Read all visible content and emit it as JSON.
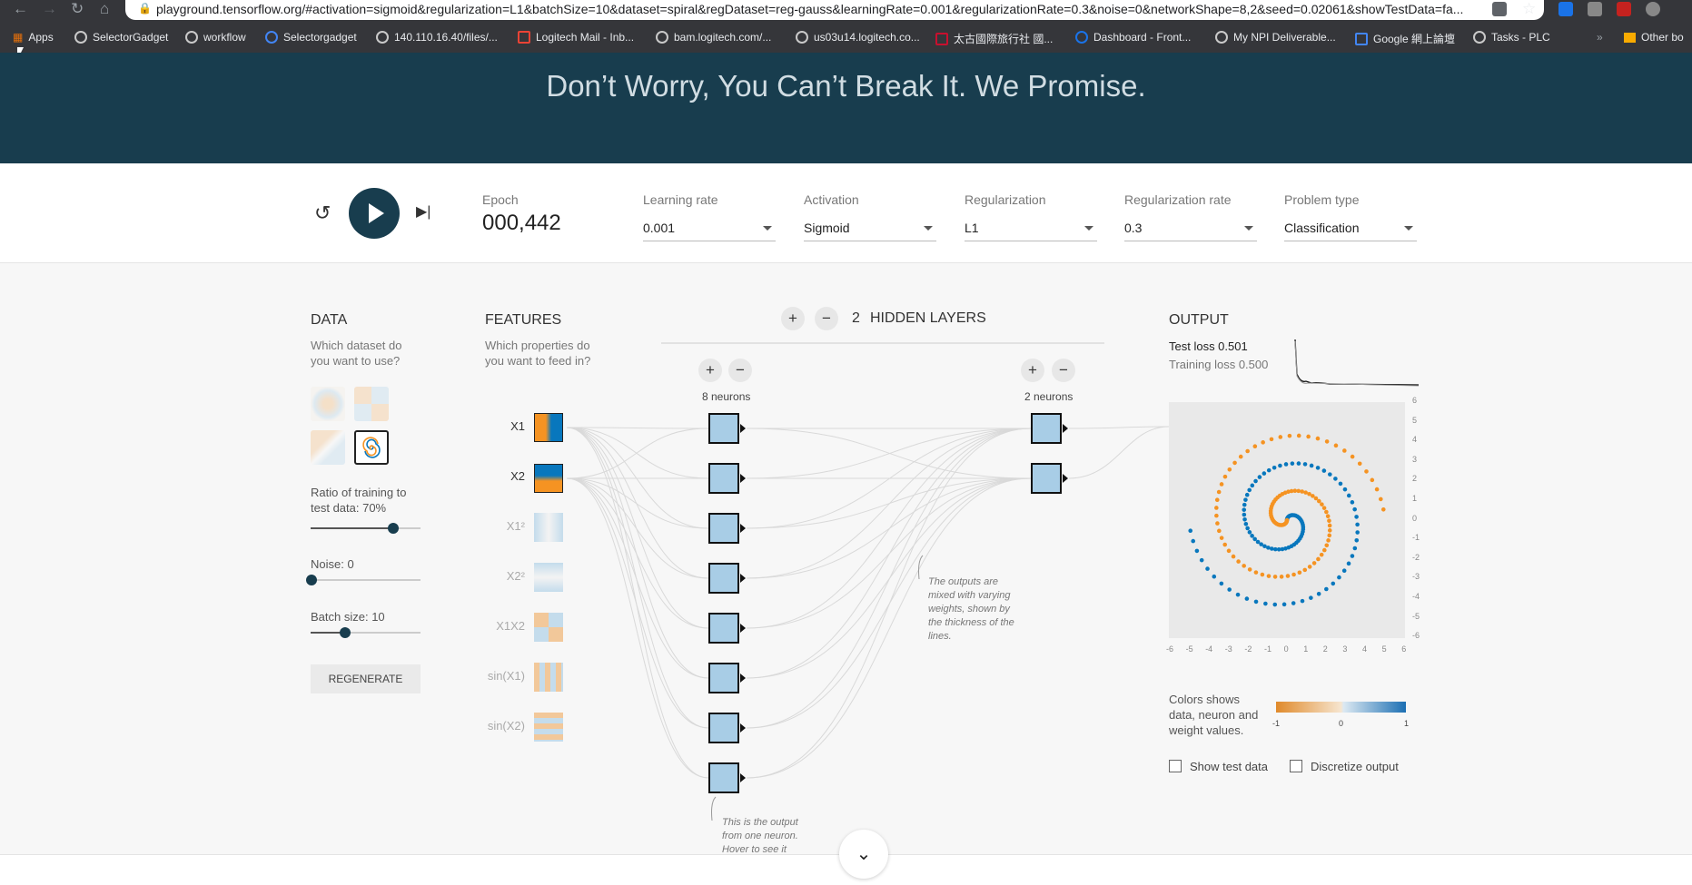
{
  "browser": {
    "url": "playground.tensorflow.org/#activation=sigmoid&regularization=L1&batchSize=10&dataset=spiral&regDataset=reg-gauss&learningRate=0.001&regularizationRate=0.3&noise=0&networkShape=8,2&seed=0.02061&showTestData=fa...",
    "bookmarks": [
      "Apps",
      "SelectorGadget",
      "workflow",
      "Selectorgadget",
      "140.110.16.40/files/...",
      "Logitech Mail - Inb...",
      "bam.logitech.com/...",
      "us03u14.logitech.co...",
      "太古國際旅行社 國...",
      "Dashboard - Front...",
      "My NPI Deliverable...",
      "Google 網上論壇",
      "Tasks - PLC",
      "Other bo"
    ]
  },
  "hero": {
    "title": "Don’t Worry, You Can’t Break It. We Promise."
  },
  "controls": {
    "epoch_label": "Epoch",
    "epoch_value": "000,442",
    "learning_rate": {
      "label": "Learning rate",
      "value": "0.001"
    },
    "activation": {
      "label": "Activation",
      "value": "Sigmoid"
    },
    "regularization": {
      "label": "Regularization",
      "value": "L1"
    },
    "regularization_rate": {
      "label": "Regularization rate",
      "value": "0.3"
    },
    "problem_type": {
      "label": "Problem type",
      "value": "Classification"
    }
  },
  "data_panel": {
    "title": "DATA",
    "subtitle": "Which dataset do you want to use?",
    "ratio_label": "Ratio of training to test data:  70%",
    "ratio_value": 70,
    "noise_label": "Noise:  0",
    "noise_value": 0,
    "batch_label": "Batch size:  10",
    "batch_value": 10,
    "regenerate": "REGENERATE"
  },
  "features_panel": {
    "title": "FEATURES",
    "subtitle": "Which properties do you want to feed in?",
    "features": [
      "X1",
      "X2",
      "X1²",
      "X2²",
      "X1X2",
      "sin(X1)",
      "sin(X2)"
    ]
  },
  "network": {
    "hidden_layers_count": "2",
    "hidden_layers_label": "HIDDEN LAYERS",
    "layers": [
      {
        "neurons_label": "8 neurons"
      },
      {
        "neurons_label": "2 neurons"
      }
    ],
    "note_weights": "The outputs are mixed with varying weights, shown by the thickness of the lines.",
    "note_neuron": "This is the output from one neuron. Hover to see it larger."
  },
  "output_panel": {
    "title": "OUTPUT",
    "test_loss": "Test loss 0.501",
    "training_loss": "Training loss 0.500",
    "y_ticks": [
      "6",
      "5",
      "4",
      "3",
      "2",
      "1",
      "0",
      "-1",
      "-2",
      "-3",
      "-4",
      "-5",
      "-6"
    ],
    "x_ticks": [
      "-6",
      "-5",
      "-4",
      "-3",
      "-2",
      "-1",
      "0",
      "1",
      "2",
      "3",
      "4",
      "5",
      "6"
    ],
    "legend_text": "Colors shows data, neuron and weight values.",
    "legend_ticks": [
      "-1",
      "0",
      "1"
    ],
    "show_test_data": "Show test data",
    "discretize_output": "Discretize output"
  },
  "colors": {
    "header_bg": "#183d4e",
    "orange": "#f59322",
    "blue": "#0877bd"
  }
}
